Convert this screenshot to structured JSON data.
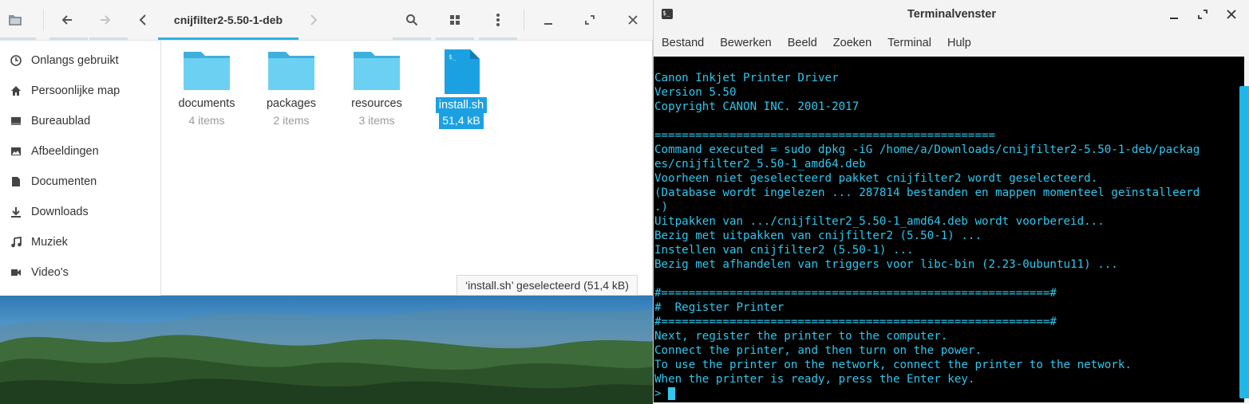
{
  "file_manager": {
    "breadcrumb": "cnijfilter2-5.50-1-deb",
    "sidebar": [
      {
        "label": "Onlangs gebruikt",
        "icon": "clock-icon"
      },
      {
        "label": "Persoonlijke map",
        "icon": "home-icon"
      },
      {
        "label": "Bureaublad",
        "icon": "desktop-icon"
      },
      {
        "label": "Afbeeldingen",
        "icon": "image-icon"
      },
      {
        "label": "Documenten",
        "icon": "document-icon"
      },
      {
        "label": "Downloads",
        "icon": "download-icon"
      },
      {
        "label": "Muziek",
        "icon": "music-icon"
      },
      {
        "label": "Video's",
        "icon": "video-icon"
      }
    ],
    "files": [
      {
        "name": "documents",
        "meta": "4 items",
        "type": "folder"
      },
      {
        "name": "packages",
        "meta": "2 items",
        "type": "folder"
      },
      {
        "name": "resources",
        "meta": "3 items",
        "type": "folder"
      },
      {
        "name": "install.sh",
        "meta": "51,4 kB",
        "type": "script",
        "selected": true
      }
    ],
    "status": "‘install.sh’ geselecteerd (51,4 kB)"
  },
  "terminal": {
    "title": "Terminalvenster",
    "menu": [
      "Bestand",
      "Bewerken",
      "Beeld",
      "Zoeken",
      "Terminal",
      "Hulp"
    ],
    "lines": [
      "Canon Inkjet Printer Driver",
      "Version 5.50",
      "Copyright CANON INC. 2001-2017",
      "",
      "==================================================",
      "Command executed = sudo dpkg -iG /home/a/Downloads/cnijfilter2-5.50-1-deb/packag",
      "es/cnijfilter2_5.50-1_amd64.deb",
      "Voorheen niet geselecteerd pakket cnijfilter2 wordt geselecteerd.",
      "(Database wordt ingelezen ... 287814 bestanden en mappen momenteel geïnstalleerd",
      ".)",
      "Uitpakken van .../cnijfilter2_5.50-1_amd64.deb wordt voorbereid...",
      "Bezig met uitpakken van cnijfilter2 (5.50-1) ...",
      "Instellen van cnijfilter2 (5.50-1) ...",
      "Bezig met afhandelen van triggers voor libc-bin (2.23-0ubuntu11) ...",
      "",
      "#=========================================================#",
      "#  Register Printer",
      "#=========================================================#",
      "Next, register the printer to the computer.",
      "Connect the printer, and then turn on the power.",
      "To use the printer on the network, connect the printer to the network.",
      "When the printer is ready, press the Enter key."
    ],
    "prompt": "> ",
    "text_color": "#2ec7ee"
  }
}
